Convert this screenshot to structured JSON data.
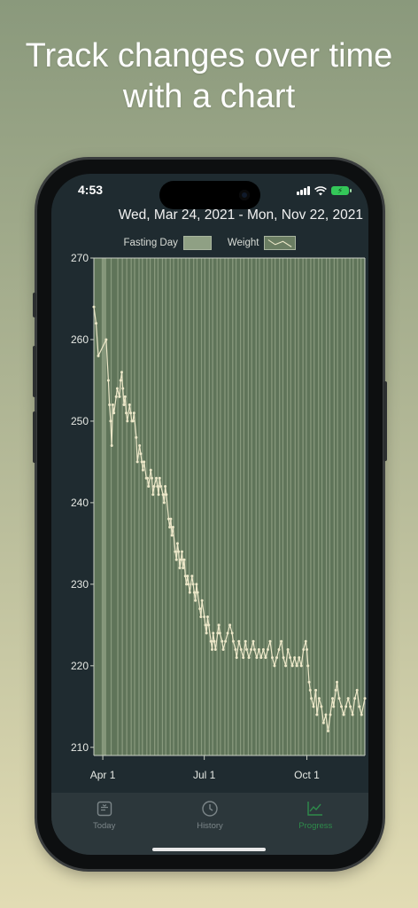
{
  "headline": "Track changes over time with a chart",
  "status": {
    "time": "4:53"
  },
  "header": {
    "date_range": "Wed, Mar 24, 2021 - Mon, Nov 22, 2021"
  },
  "legend": {
    "fasting_label": "Fasting Day",
    "weight_label": "Weight"
  },
  "colors": {
    "plot_bg": "#5f7459",
    "fasting_band": "#8fa084",
    "weight_line": "#ece7c8",
    "active_tab": "#2e8b4b"
  },
  "tabs": [
    {
      "label": "Today",
      "icon": "today-icon",
      "active": false
    },
    {
      "label": "History",
      "icon": "clock-icon",
      "active": false
    },
    {
      "label": "Progress",
      "icon": "chart-icon",
      "active": true
    }
  ],
  "chart_data": {
    "type": "line",
    "title": "",
    "xlabel": "",
    "ylabel": "",
    "x_range": [
      "2021-03-24",
      "2021-11-22"
    ],
    "ylim": [
      209,
      270
    ],
    "y_ticks": [
      210,
      220,
      230,
      240,
      250,
      260,
      270
    ],
    "x_ticks": [
      {
        "date": "2021-04-01",
        "label": "Apr 1"
      },
      {
        "date": "2021-07-01",
        "label": "Jul 1"
      },
      {
        "date": "2021-10-01",
        "label": "Oct 1"
      }
    ],
    "series": [
      {
        "name": "Weight",
        "points": [
          [
            "2021-03-24",
            264
          ],
          [
            "2021-03-26",
            262
          ],
          [
            "2021-03-28",
            258
          ],
          [
            "2021-04-04",
            260
          ],
          [
            "2021-04-06",
            255
          ],
          [
            "2021-04-07",
            252
          ],
          [
            "2021-04-08",
            250
          ],
          [
            "2021-04-09",
            247
          ],
          [
            "2021-04-10",
            252
          ],
          [
            "2021-04-11",
            251
          ],
          [
            "2021-04-13",
            253
          ],
          [
            "2021-04-14",
            254
          ],
          [
            "2021-04-16",
            253
          ],
          [
            "2021-04-17",
            255
          ],
          [
            "2021-04-18",
            256
          ],
          [
            "2021-04-19",
            254
          ],
          [
            "2021-04-20",
            252
          ],
          [
            "2021-04-21",
            253
          ],
          [
            "2021-04-22",
            251
          ],
          [
            "2021-04-23",
            250
          ],
          [
            "2021-04-25",
            252
          ],
          [
            "2021-04-26",
            251
          ],
          [
            "2021-04-27",
            250
          ],
          [
            "2021-04-28",
            250
          ],
          [
            "2021-04-29",
            251
          ],
          [
            "2021-05-01",
            248
          ],
          [
            "2021-05-02",
            245
          ],
          [
            "2021-05-04",
            247
          ],
          [
            "2021-05-05",
            246
          ],
          [
            "2021-05-06",
            245
          ],
          [
            "2021-05-07",
            244
          ],
          [
            "2021-05-08",
            245
          ],
          [
            "2021-05-10",
            243
          ],
          [
            "2021-05-11",
            243
          ],
          [
            "2021-05-12",
            242
          ],
          [
            "2021-05-14",
            244
          ],
          [
            "2021-05-15",
            243
          ],
          [
            "2021-05-16",
            241
          ],
          [
            "2021-05-17",
            242
          ],
          [
            "2021-05-19",
            243
          ],
          [
            "2021-05-20",
            242
          ],
          [
            "2021-05-21",
            241
          ],
          [
            "2021-05-22",
            243
          ],
          [
            "2021-05-23",
            242
          ],
          [
            "2021-05-25",
            241
          ],
          [
            "2021-05-26",
            240
          ],
          [
            "2021-05-27",
            242
          ],
          [
            "2021-05-28",
            241
          ],
          [
            "2021-05-30",
            238
          ],
          [
            "2021-05-31",
            237
          ],
          [
            "2021-06-01",
            238
          ],
          [
            "2021-06-02",
            236
          ],
          [
            "2021-06-03",
            237
          ],
          [
            "2021-06-05",
            234
          ],
          [
            "2021-06-06",
            233
          ],
          [
            "2021-06-07",
            235
          ],
          [
            "2021-06-08",
            234
          ],
          [
            "2021-06-09",
            232
          ],
          [
            "2021-06-10",
            233
          ],
          [
            "2021-06-11",
            234
          ],
          [
            "2021-06-12",
            232
          ],
          [
            "2021-06-13",
            233
          ],
          [
            "2021-06-14",
            231
          ],
          [
            "2021-06-15",
            230
          ],
          [
            "2021-06-16",
            231
          ],
          [
            "2021-06-17",
            230
          ],
          [
            "2021-06-18",
            229
          ],
          [
            "2021-06-20",
            231
          ],
          [
            "2021-06-21",
            230
          ],
          [
            "2021-06-22",
            229
          ],
          [
            "2021-06-23",
            228
          ],
          [
            "2021-06-24",
            230
          ],
          [
            "2021-06-25",
            229
          ],
          [
            "2021-06-27",
            227
          ],
          [
            "2021-06-28",
            226
          ],
          [
            "2021-06-29",
            228
          ],
          [
            "2021-07-01",
            226
          ],
          [
            "2021-07-02",
            225
          ],
          [
            "2021-07-03",
            224
          ],
          [
            "2021-07-04",
            226
          ],
          [
            "2021-07-05",
            225
          ],
          [
            "2021-07-07",
            223
          ],
          [
            "2021-07-08",
            222
          ],
          [
            "2021-07-09",
            224
          ],
          [
            "2021-07-10",
            223
          ],
          [
            "2021-07-11",
            222
          ],
          [
            "2021-07-13",
            224
          ],
          [
            "2021-07-14",
            225
          ],
          [
            "2021-07-15",
            224
          ],
          [
            "2021-07-17",
            223
          ],
          [
            "2021-07-18",
            222
          ],
          [
            "2021-07-20",
            223
          ],
          [
            "2021-07-22",
            224
          ],
          [
            "2021-07-24",
            225
          ],
          [
            "2021-07-26",
            224
          ],
          [
            "2021-07-27",
            223
          ],
          [
            "2021-07-29",
            222
          ],
          [
            "2021-07-30",
            221
          ],
          [
            "2021-08-01",
            223
          ],
          [
            "2021-08-03",
            222
          ],
          [
            "2021-08-05",
            221
          ],
          [
            "2021-08-07",
            223
          ],
          [
            "2021-08-08",
            222
          ],
          [
            "2021-08-10",
            221
          ],
          [
            "2021-08-12",
            222
          ],
          [
            "2021-08-14",
            223
          ],
          [
            "2021-08-15",
            222
          ],
          [
            "2021-08-17",
            221
          ],
          [
            "2021-08-19",
            222
          ],
          [
            "2021-08-21",
            221
          ],
          [
            "2021-08-23",
            222
          ],
          [
            "2021-08-25",
            221
          ],
          [
            "2021-08-27",
            222
          ],
          [
            "2021-08-29",
            223
          ],
          [
            "2021-08-31",
            221
          ],
          [
            "2021-09-02",
            220
          ],
          [
            "2021-09-04",
            221
          ],
          [
            "2021-09-06",
            222
          ],
          [
            "2021-09-08",
            223
          ],
          [
            "2021-09-10",
            221
          ],
          [
            "2021-09-12",
            220
          ],
          [
            "2021-09-14",
            222
          ],
          [
            "2021-09-16",
            221
          ],
          [
            "2021-09-18",
            220
          ],
          [
            "2021-09-20",
            221
          ],
          [
            "2021-09-22",
            220
          ],
          [
            "2021-09-24",
            221
          ],
          [
            "2021-09-26",
            220
          ],
          [
            "2021-09-28",
            222
          ],
          [
            "2021-09-30",
            223
          ],
          [
            "2021-10-01",
            222
          ],
          [
            "2021-10-02",
            220
          ],
          [
            "2021-10-03",
            218
          ],
          [
            "2021-10-04",
            217
          ],
          [
            "2021-10-05",
            216
          ],
          [
            "2021-10-07",
            215
          ],
          [
            "2021-10-09",
            217
          ],
          [
            "2021-10-10",
            214
          ],
          [
            "2021-10-12",
            216
          ],
          [
            "2021-10-14",
            215
          ],
          [
            "2021-10-16",
            213
          ],
          [
            "2021-10-18",
            214
          ],
          [
            "2021-10-20",
            212
          ],
          [
            "2021-10-22",
            214
          ],
          [
            "2021-10-24",
            216
          ],
          [
            "2021-10-25",
            215
          ],
          [
            "2021-10-27",
            217
          ],
          [
            "2021-10-28",
            218
          ],
          [
            "2021-10-30",
            216
          ],
          [
            "2021-11-01",
            215
          ],
          [
            "2021-11-03",
            214
          ],
          [
            "2021-11-05",
            215
          ],
          [
            "2021-11-07",
            216
          ],
          [
            "2021-11-09",
            215
          ],
          [
            "2021-11-11",
            214
          ],
          [
            "2021-11-13",
            216
          ],
          [
            "2021-11-15",
            217
          ],
          [
            "2021-11-17",
            215
          ],
          [
            "2021-11-19",
            214
          ],
          [
            "2021-11-22",
            216
          ]
        ]
      }
    ],
    "fasting_days": [
      "2021-03-31",
      "2021-04-01",
      "2021-04-02",
      "2021-04-03",
      "2021-04-08",
      "2021-04-14",
      "2021-04-18",
      "2021-04-22",
      "2021-04-26",
      "2021-04-29",
      "2021-05-03",
      "2021-05-06",
      "2021-05-10",
      "2021-05-13",
      "2021-05-17",
      "2021-05-20",
      "2021-05-24",
      "2021-05-27",
      "2021-05-31",
      "2021-06-03",
      "2021-06-07",
      "2021-06-10",
      "2021-06-14",
      "2021-06-17",
      "2021-06-21",
      "2021-06-24",
      "2021-06-28",
      "2021-07-01",
      "2021-07-05",
      "2021-07-08",
      "2021-07-12",
      "2021-07-15",
      "2021-07-19",
      "2021-07-22",
      "2021-07-26",
      "2021-07-29",
      "2021-08-02",
      "2021-08-05",
      "2021-08-09",
      "2021-08-12",
      "2021-08-16",
      "2021-08-19",
      "2021-08-23",
      "2021-08-26",
      "2021-08-30",
      "2021-09-02",
      "2021-09-06",
      "2021-09-09",
      "2021-09-13",
      "2021-09-16",
      "2021-09-20",
      "2021-09-23",
      "2021-09-27",
      "2021-09-30",
      "2021-10-04",
      "2021-10-07",
      "2021-10-11",
      "2021-10-14",
      "2021-10-18",
      "2021-10-21",
      "2021-10-25",
      "2021-10-28",
      "2021-11-01",
      "2021-11-04",
      "2021-11-08",
      "2021-11-11",
      "2021-11-15",
      "2021-11-18"
    ],
    "grid": false,
    "legend_position": "top-center"
  }
}
